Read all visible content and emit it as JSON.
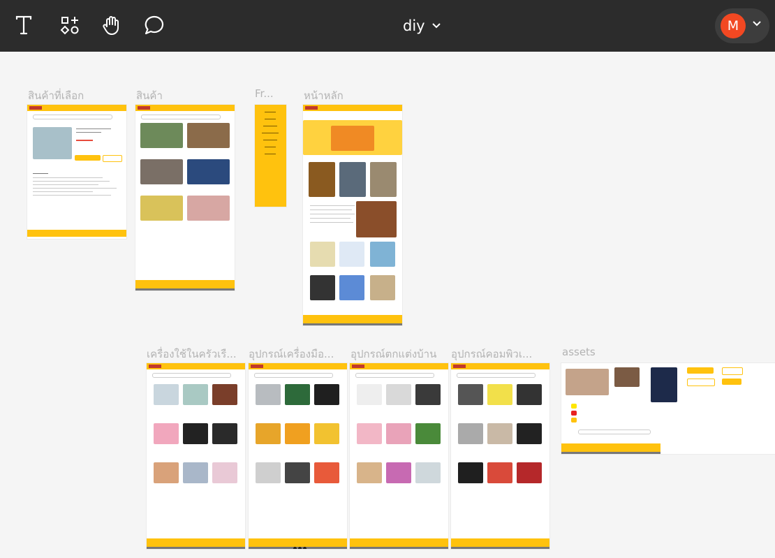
{
  "toolbar": {
    "tools": [
      {
        "name": "text-tool",
        "icon": "text-icon"
      },
      {
        "name": "shapes-tool",
        "icon": "shapes-plus-icon"
      },
      {
        "name": "hand-tool",
        "icon": "hand-icon"
      },
      {
        "name": "comment-tool",
        "icon": "comment-icon"
      }
    ],
    "file_title": "diy",
    "title_dropdown_icon": "chevron-down-icon",
    "user_initial": "M",
    "user_color": "#f24822",
    "user_menu_icon": "chevron-down-icon"
  },
  "canvas": {
    "frames": [
      {
        "label": "สินค้าที่เลือก"
      },
      {
        "label": "สินค้า"
      },
      {
        "label": "Fr..."
      },
      {
        "label": "หน้าหลัก"
      },
      {
        "label": "เครื่องใช้ในครัวเรื..."
      },
      {
        "label": "อุปกรณ์เครื่องมือ..."
      },
      {
        "label": "อุปกรณ์ตกแต่งบ้าน"
      },
      {
        "label": "อุปกรณ์คอมพิวเ..."
      },
      {
        "label": "assets"
      }
    ]
  },
  "colors": {
    "brand_yellow": "#ffc20e",
    "toolbar_bg": "#2c2c2c",
    "canvas_bg": "#f5f5f5",
    "sale_red": "#e74c3c"
  }
}
